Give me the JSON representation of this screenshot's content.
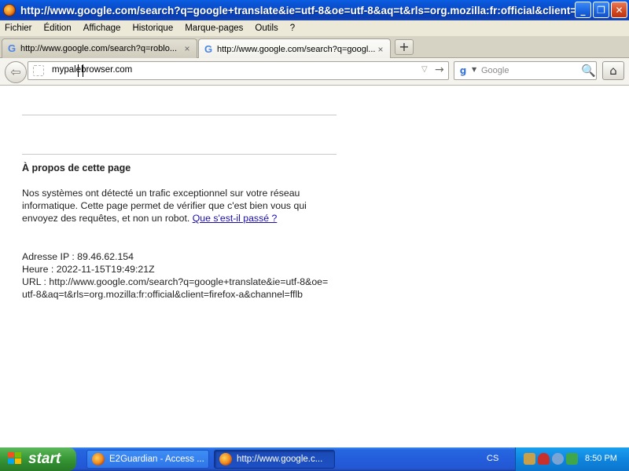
{
  "window": {
    "title": "http://www.google.com/search?q=google+translate&ie=utf-8&oe=utf-8&aq=t&rls=org.mozilla:fr:official&client=...",
    "minimize": "_",
    "maximize": "❐",
    "close": "✕"
  },
  "menu": [
    "Fichier",
    "Édition",
    "Affichage",
    "Historique",
    "Marque-pages",
    "Outils",
    "?"
  ],
  "tabs": [
    {
      "label": "http://www.google.com/search?q=roblo...",
      "favicon": "G",
      "close": "×"
    },
    {
      "label": "http://www.google.com/search?q=googl...",
      "favicon": "G",
      "close": "×"
    }
  ],
  "new_tab": "+",
  "nav": {
    "back": "⇦",
    "url": "mypalebrowser.com",
    "dropdown": "▽",
    "go": "→",
    "search_engine": "g",
    "search_arrow": "▼",
    "search_placeholder": "Google",
    "search_icon": "🔍",
    "home": "⌂"
  },
  "page": {
    "heading": "À propos de cette page",
    "para": "Nos systèmes ont détecté un trafic exceptionnel sur votre réseau informatique. Cette page permet de vérifier que c'est bien vous qui envoyez des requêtes, et non un robot.",
    "link": "Que s'est-il passé ?",
    "ip": "Adresse IP : 89.46.62.154",
    "time": "Heure : 2022-11-15T19:49:21Z",
    "url": "URL : http://www.google.com/search?q=google+translate&ie=utf-8&oe=utf-8&aq=t&rls=org.mozilla:fr:official&client=firefox-a&channel=fflb"
  },
  "taskbar": {
    "start": "start",
    "tasks": [
      {
        "label": "E2Guardian - Access ..."
      },
      {
        "label": "http://www.google.c..."
      }
    ],
    "lang": "CS",
    "clock": "8:50 PM"
  }
}
